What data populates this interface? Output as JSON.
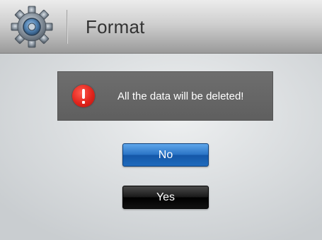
{
  "header": {
    "icon": "gear-icon",
    "title": "Format"
  },
  "alert": {
    "icon": "warning-icon",
    "icon_color": "#e0241c",
    "message": "All the data will be deleted!"
  },
  "buttons": {
    "no_label": "No",
    "yes_label": "Yes",
    "no_color": "#2b74c6",
    "yes_color": "#111111"
  }
}
